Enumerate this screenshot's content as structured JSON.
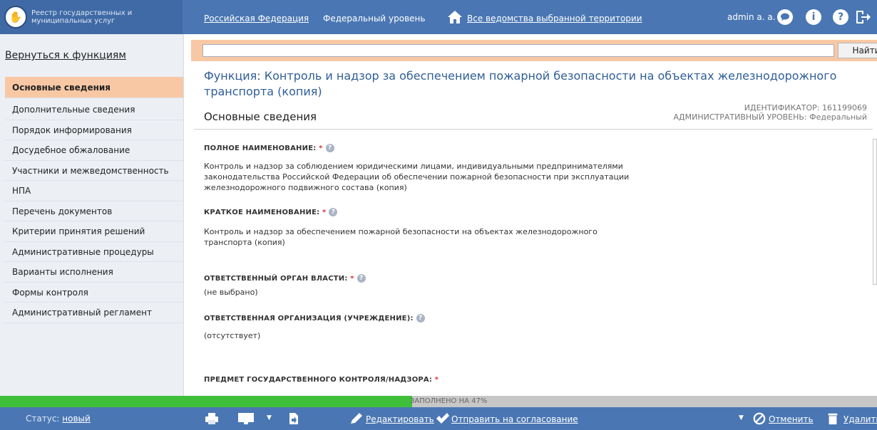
{
  "header": {
    "logo_text": "Реестр государственных и муниципальных услуг",
    "nav_federation": "Российская Федерация",
    "nav_level": "Федеральный уровень",
    "nav_agencies": "Все ведомства выбранной территории",
    "user": "admin a. a.",
    "icons": [
      "chat-icon",
      "info-icon",
      "help-icon",
      "logout-icon"
    ]
  },
  "sidebar": {
    "back_link": "Вернуться к функциям",
    "items": [
      {
        "label": "Основные сведения",
        "active": true
      },
      {
        "label": "Дополнительные сведения"
      },
      {
        "label": "Порядок информирования"
      },
      {
        "label": "Досудебное обжалование"
      },
      {
        "label": "Участники и межведомственность"
      },
      {
        "label": "НПА"
      },
      {
        "label": "Перечень документов"
      },
      {
        "label": "Критерии принятия решений"
      },
      {
        "label": "Административные процедуры"
      },
      {
        "label": "Варианты исполнения"
      },
      {
        "label": "Формы контроля"
      },
      {
        "label": "Административный регламент"
      }
    ]
  },
  "search": {
    "value": "",
    "button": "Найти"
  },
  "main": {
    "function_title": "Функция:  Контроль и надзор за обеспечением пожарной безопасности на объектах железнодорожного транспорта (копия)",
    "section_title": "Основные сведения",
    "identifier": "ИДЕНТИФИКАТОР: 161199069",
    "admin_level": "АДМИНИСТРАТИВНЫЙ УРОВЕНЬ: Федеральный",
    "fields": {
      "full_name_label": "ПОЛНОЕ НАИМЕНОВАНИЕ:",
      "full_name_value": " Контроль и надзор за соблюдением юридическими лицами, индивидуальными предпринимателями законодательства Российской Федерации об обеспечении пожарной безопасности при эксплуатации железнодорожного подвижного состава (копия)",
      "short_name_label": "КРАТКОЕ НАИМЕНОВАНИЕ:",
      "short_name_value": " Контроль и надзор за обеспечением пожарной безопасности на объектах железнодорожного транспорта (копия)",
      "authority_label": "ОТВЕТСТВЕННЫЙ ОРГАН ВЛАСТИ:",
      "authority_value": "(не выбрано)",
      "org_label": "ОТВЕТСТВЕННАЯ ОРГАНИЗАЦИЯ (УЧРЕЖДЕНИЕ):",
      "org_value": "(отсутствует)",
      "subject_label": "ПРЕДМЕТ ГОСУДАРСТВЕННОГО КОНТРОЛЯ/НАДЗОРА:",
      "required_mark": "*"
    }
  },
  "progress": {
    "percent": 47,
    "label": "ЗАПОЛНЕНО НА 47%"
  },
  "footer": {
    "status_label": "Статус:",
    "status_value": "новый",
    "edit": "Редактировать",
    "send": "Отправить на согласование",
    "cancel": "Отменить",
    "delete": "Удалить"
  },
  "colors": {
    "header_blue": "#4a77b3",
    "accent_peach": "#f8c8a5",
    "progress_green": "#3fbf3a",
    "title_blue": "#2f5e98"
  }
}
